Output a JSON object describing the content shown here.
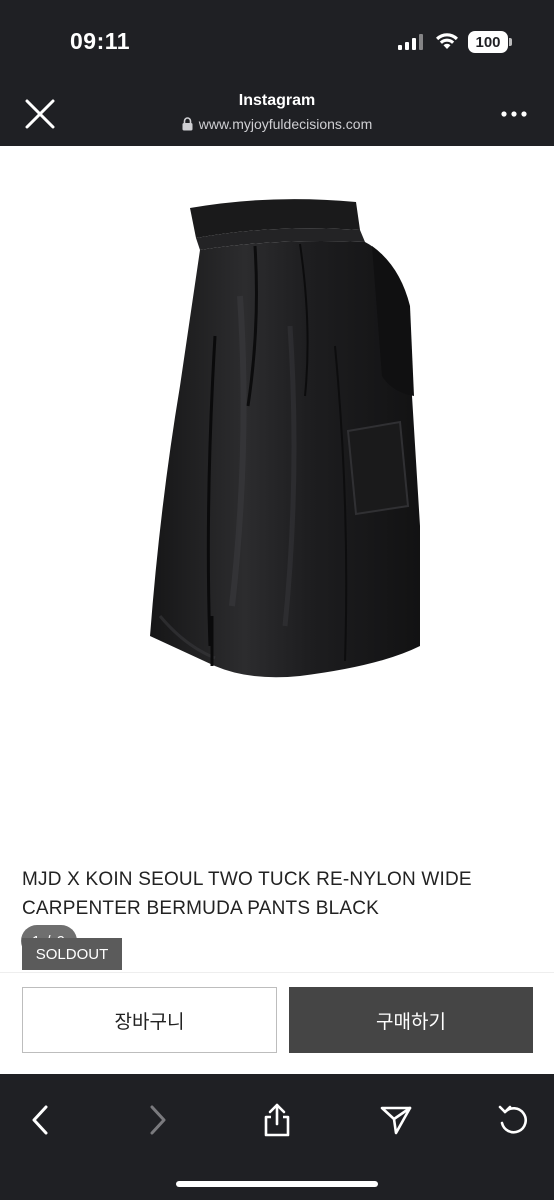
{
  "status_bar": {
    "time": "09:11",
    "battery": "100"
  },
  "browser": {
    "title": "Instagram",
    "url": "www.myjoyfuldecisions.com",
    "close_icon": "close-icon",
    "more_icon": "more-icon",
    "lock_icon": "lock-icon"
  },
  "product": {
    "image_counter": "1 / 9",
    "title": "MJD X KOIN SEOUL TWO TUCK RE-NYLON WIDE CARPENTER BERMUDA PANTS BLACK",
    "status_badge": "SOLDOUT"
  },
  "actions": {
    "cart_label": "장바구니",
    "buy_label": "구매하기"
  },
  "bottom_nav": {
    "items": [
      "back-icon",
      "forward-icon",
      "share-icon",
      "send-icon",
      "refresh-icon"
    ]
  },
  "colors": {
    "chrome_background": "#1f2024",
    "buy_button": "#454545",
    "soldout_badge": "#5b5b5b",
    "counter_pill": "#6f6f6f"
  }
}
